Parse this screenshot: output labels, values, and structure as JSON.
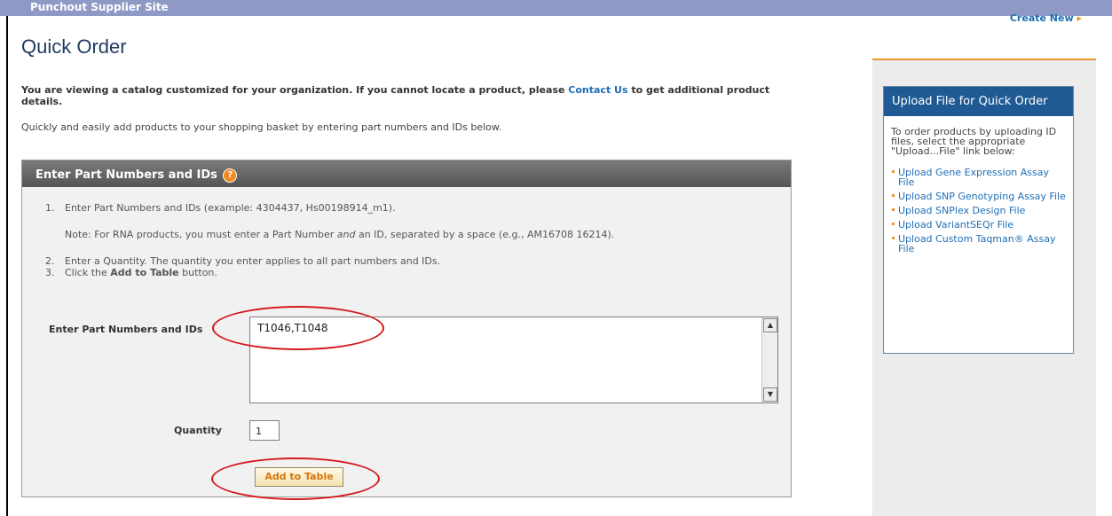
{
  "topbar": {
    "title": "Punchout Supplier Site"
  },
  "page": {
    "title": "Quick Order",
    "intro_before_link": "You are viewing a catalog customized for your organization. If you cannot locate a product, please ",
    "intro_link": "Contact Us",
    "intro_after_link": " to get additional product details.",
    "subintro": "Quickly and easily add products to your shopping basket by entering part numbers and IDs below."
  },
  "panel": {
    "header": "Enter Part Numbers and IDs",
    "help_icon": "question-mark-icon",
    "steps": [
      {
        "num": "1.",
        "text": "Enter Part Numbers and IDs (example: 4304437, Hs00198914_m1)."
      },
      {
        "num": "",
        "text_before": "Note: For RNA products, you must enter a Part Number ",
        "text_em": "and",
        "text_after": " an ID, separated by a space (e.g., AM16708 16214)."
      },
      {
        "num": "2.",
        "text": "Enter a Quantity. The quantity you enter applies to all part numbers and IDs."
      },
      {
        "num": "3.",
        "text_before": "Click the ",
        "text_bold": "Add to Table",
        "text_after": " button."
      }
    ],
    "part_label": "Enter Part Numbers and IDs",
    "part_value": "T1046,T1048",
    "qty_label": "Quantity",
    "qty_value": "1",
    "add_button": "Add to Table"
  },
  "sidebar": {
    "top_link": "Create New",
    "upload_header": "Upload File for Quick Order",
    "upload_desc": "To order products by uploading ID files, select the appropriate \"Upload...File\" link below:",
    "links": [
      "Upload Gene Expression Assay File",
      "Upload SNP Genotyping Assay File",
      "Upload SNPlex Design File",
      "Upload VariantSEQr File",
      "Upload Custom Taqman® Assay File"
    ]
  },
  "annotation_color": "#d6171c"
}
